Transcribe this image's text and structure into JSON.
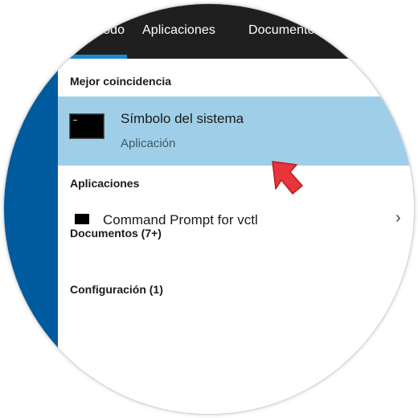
{
  "tabs": [
    {
      "label": "Todo"
    },
    {
      "label": "Aplicaciones"
    },
    {
      "label": "Documentos"
    }
  ],
  "sections": {
    "best_match": "Mejor coincidencia",
    "apps": "Aplicaciones",
    "documents": "Documentos (7+)",
    "settings": "Configuración (1)"
  },
  "best_result": {
    "title": "Símbolo del sistema",
    "subtitle": "Aplicación",
    "icon": "command-prompt-icon"
  },
  "app_results": [
    {
      "label": "Command Prompt for vctl",
      "icon": "command-prompt-icon"
    }
  ],
  "colors": {
    "topbar": "#1f1f1f",
    "sidebar": "#005a9e",
    "selection": "#9fcfe8",
    "tab_indicator": "#1a8ad6",
    "pointer_arrow": "#e8343b"
  }
}
